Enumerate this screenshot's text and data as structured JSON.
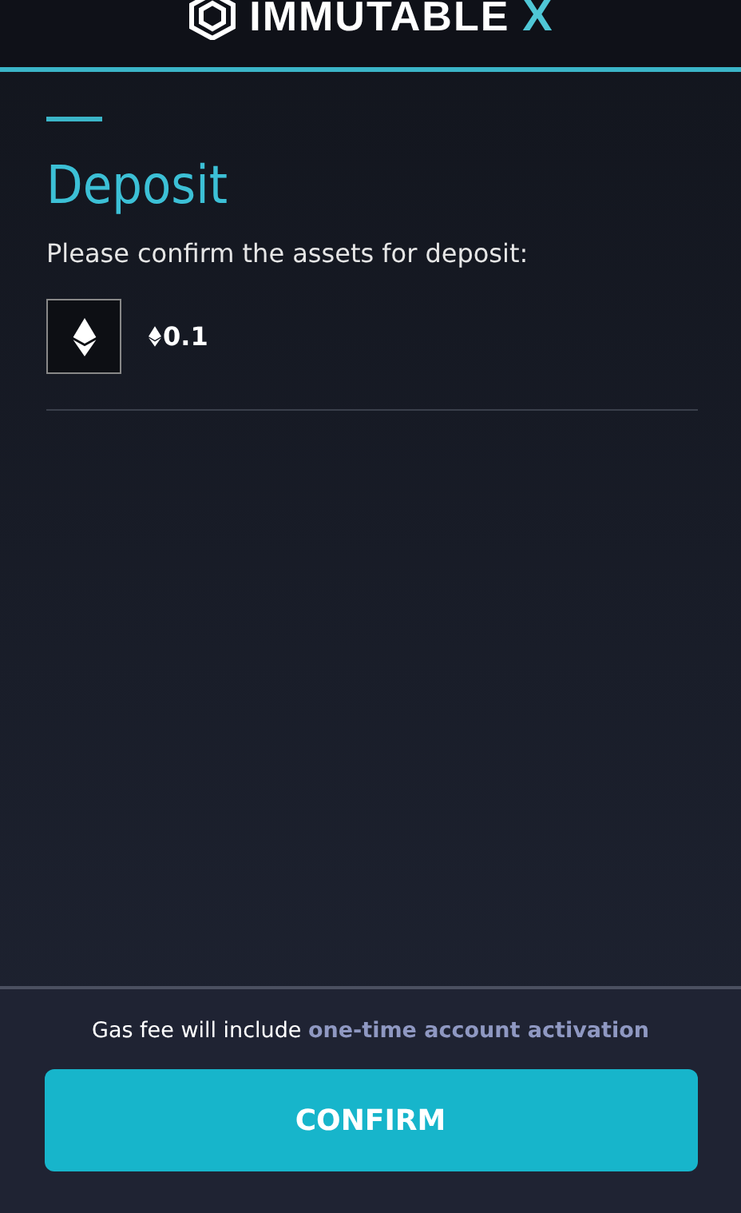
{
  "header": {
    "logo_text": "IMMUTABLE",
    "logo_mark": "X"
  },
  "title": "Deposit",
  "subtitle": "Please confirm the assets for deposit:",
  "assets": [
    {
      "amount": "0.1"
    }
  ],
  "footer": {
    "note": "Gas fee will include",
    "note_link": "one-time account activation",
    "button": "CONFIRM"
  }
}
